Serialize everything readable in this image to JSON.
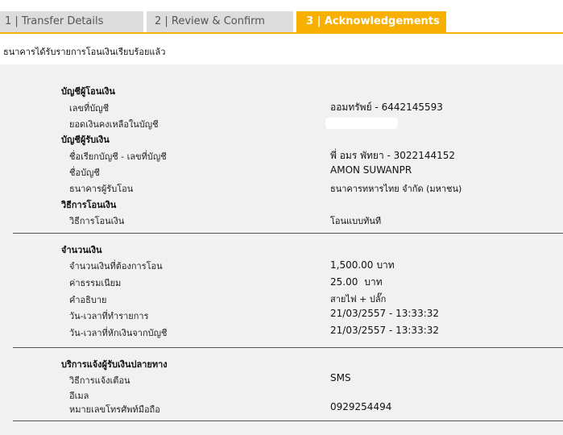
{
  "tabs": [
    {
      "label": "1 | Transfer Details"
    },
    {
      "label": "2 | Review & Confirm"
    },
    {
      "label": "3 | Acknowledgements"
    }
  ],
  "note": "ธนาคารได้รับรายการโอนเงินเรียบร้อยแล้ว",
  "sections": {
    "from_account": {
      "title": "บัญชีผู้โอนเงิน",
      "account_no_label": "เลขที่บัญชี",
      "account_no_value": "ออมทรัพย์ - 6442145593",
      "balance_label": "ยอดเงินคงเหลือในบัญชี"
    },
    "to_account": {
      "title": "บัญชีผู้รับเงิน",
      "name_no_label": "ชื่อเรียกบัญชี - เลขที่บัญชี",
      "name_no_value": "พี่ อมร พัทยา - 3022144152",
      "account_name_label": "ชื่อบัญชี",
      "account_name_value": "AMON SUWANPR",
      "bank_label": "ธนาคารผู้รับโอน",
      "bank_value": "ธนาคารทหารไทย จำกัด (มหาชน)"
    },
    "method": {
      "title": "วิธีการโอนเงิน",
      "method_label": "วิธีการโอนเงิน",
      "method_value": "โอนแบบทันที"
    },
    "amount": {
      "title": "จำนวนเงิน",
      "amount_label": "จำนวนเงินที่ต้องการโอน",
      "amount_value": "1,500.00",
      "amount_unit": "บาท",
      "fee_label": "ค่าธรรมเนียม",
      "fee_value": "25.00",
      "fee_unit": "บาท",
      "desc_label": "คำอธิบาย",
      "desc_value": "สายไฟ + ปลั๊ก",
      "txn_time_label": "วัน-เวลาที่ทำรายการ",
      "txn_time_value": "21/03/2557 - 13:33:32",
      "debit_time_label": "วัน-เวลาที่หักเงินจากบัญชี",
      "debit_time_value": "21/03/2557 - 13:33:32"
    },
    "notify": {
      "title": "บริการแจ้งผู้รับเงินปลายทาง",
      "method_label": "วิธีการแจ้งเตือน",
      "method_value": "SMS",
      "email_label": "อีเมล",
      "phone_label": "หมายเลขโทรศัพท์มือถือ",
      "phone_value": "0929254494"
    }
  }
}
